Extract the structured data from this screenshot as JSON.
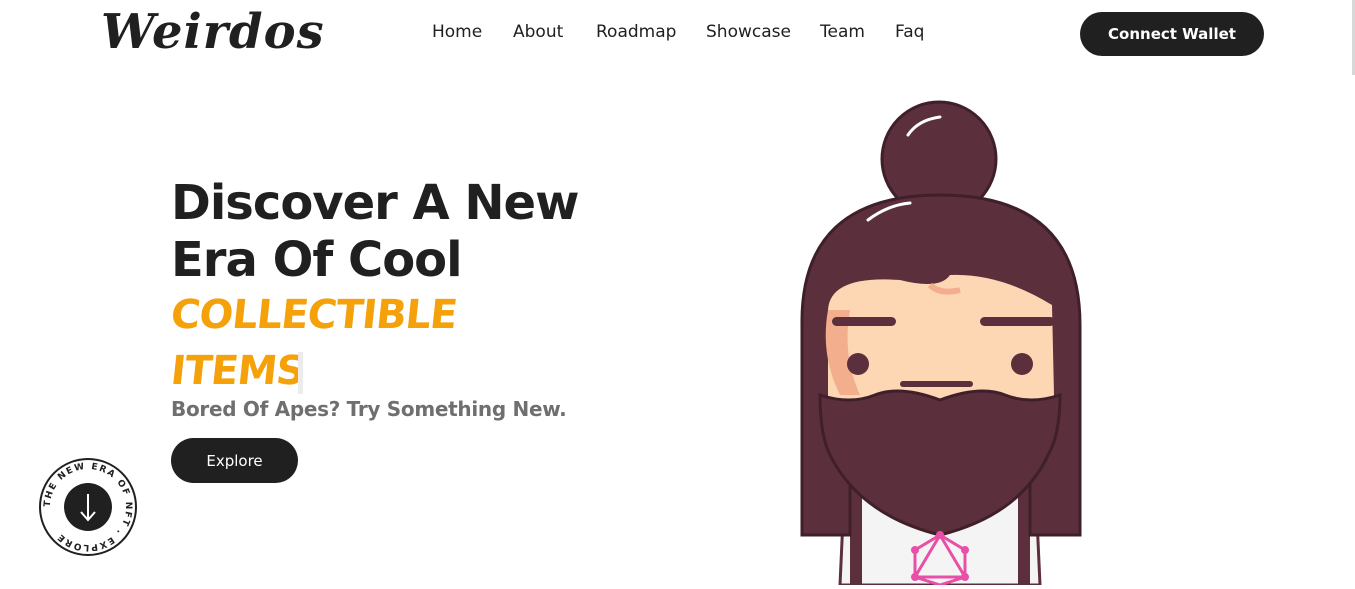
{
  "header": {
    "logo": "Weirdos",
    "nav": [
      {
        "label": "Home"
      },
      {
        "label": "About"
      },
      {
        "label": "Roadmap"
      },
      {
        "label": "Showcase"
      },
      {
        "label": "Team"
      },
      {
        "label": "Faq"
      }
    ],
    "connect_label": "Connect Wallet"
  },
  "hero": {
    "title_line1": "Discover A New",
    "title_line2": "Era Of Cool",
    "accent_line1": "COLLECTIBLE",
    "accent_line2": "ITEMS",
    "subtitle": "Bored Of Apes? Try Something New.",
    "explore_label": "Explore"
  },
  "badge": {
    "ring_text": "THE NEW ERA OF NFT . EXPLORE"
  },
  "colors": {
    "dark": "#202020",
    "accent": "#f5a10a",
    "hair": "#5c2f3d",
    "skin": "#fdd7b4"
  },
  "icons": {
    "badge_arrow": "arrow-down-icon"
  }
}
